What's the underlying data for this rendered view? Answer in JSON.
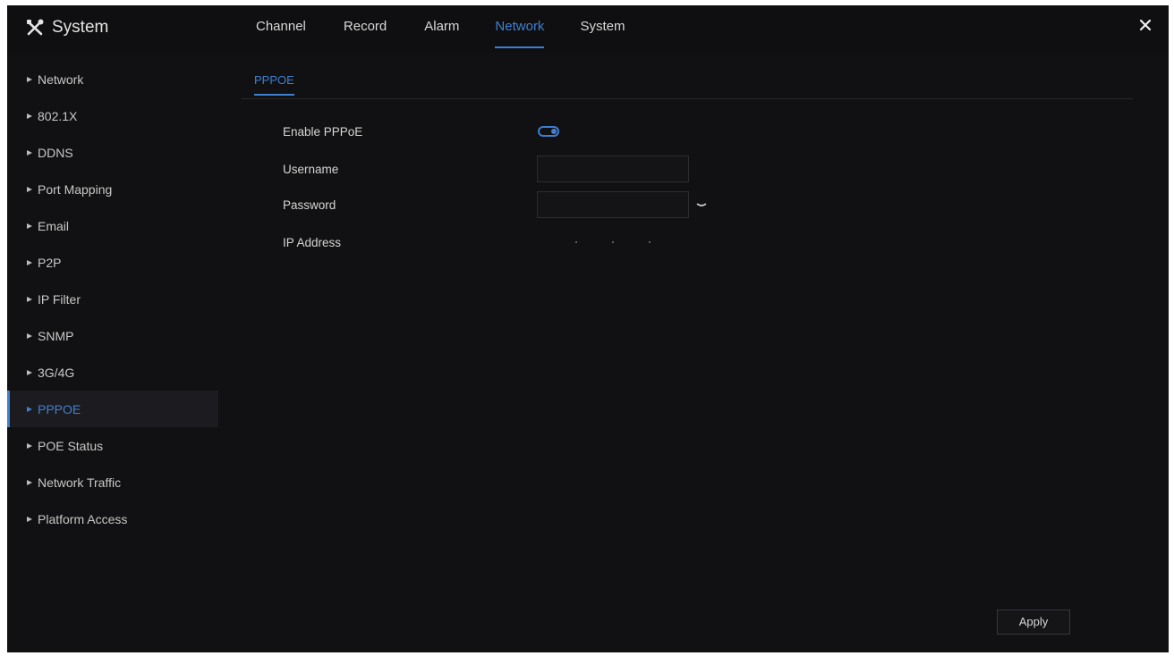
{
  "header": {
    "title": "System",
    "tabs": [
      {
        "label": "Channel",
        "active": false
      },
      {
        "label": "Record",
        "active": false
      },
      {
        "label": "Alarm",
        "active": false
      },
      {
        "label": "Network",
        "active": true
      },
      {
        "label": "System",
        "active": false
      }
    ],
    "close_icon": "close-icon"
  },
  "sidebar": {
    "items": [
      {
        "label": "Network",
        "active": false
      },
      {
        "label": "802.1X",
        "active": false
      },
      {
        "label": "DDNS",
        "active": false
      },
      {
        "label": "Port Mapping",
        "active": false
      },
      {
        "label": "Email",
        "active": false
      },
      {
        "label": "P2P",
        "active": false
      },
      {
        "label": "IP Filter",
        "active": false
      },
      {
        "label": "SNMP",
        "active": false
      },
      {
        "label": "3G/4G",
        "active": false
      },
      {
        "label": "PPPOE",
        "active": true
      },
      {
        "label": "POE Status",
        "active": false
      },
      {
        "label": "Network Traffic",
        "active": false
      },
      {
        "label": "Platform Access",
        "active": false
      }
    ]
  },
  "main": {
    "subtab": "PPPOE",
    "form": {
      "enable_label": "Enable PPPoE",
      "enable_value": true,
      "username_label": "Username",
      "username_value": "",
      "password_label": "Password",
      "password_value": "",
      "ip_label": "IP Address",
      "ip_value": "",
      "password_toggle_icon": "eye-icon"
    },
    "apply_label": "Apply"
  },
  "colors": {
    "accent": "#3f7fd0",
    "background": "#111113",
    "text": "#d6d6d6"
  }
}
